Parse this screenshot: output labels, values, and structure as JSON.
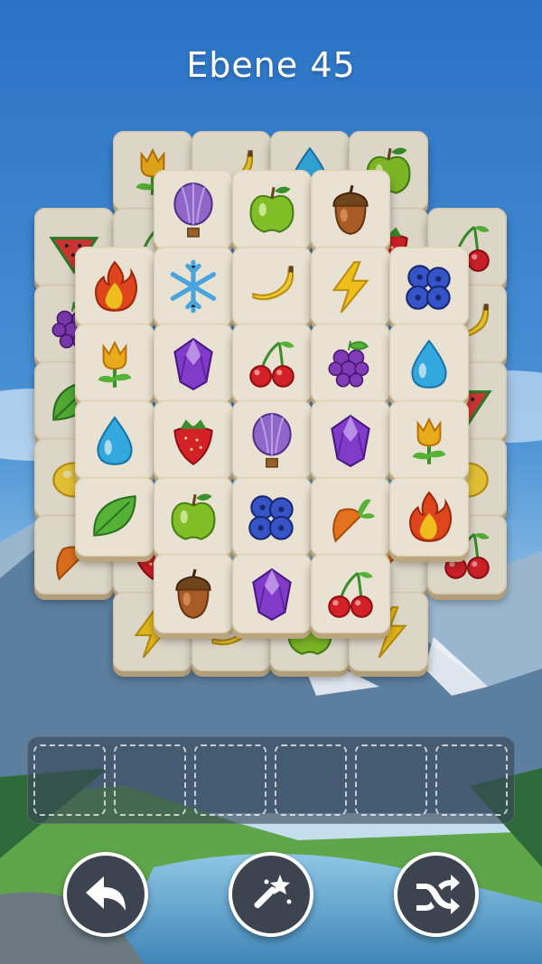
{
  "level": {
    "title": "Ebene 45"
  },
  "colors": {
    "tile_face": "#faf3e2",
    "tile_edge": "#c9b28a",
    "control_bg": "#3d4450"
  },
  "tray": {
    "slot_count": 6,
    "filled": 0
  },
  "controls": [
    {
      "name": "undo-button",
      "icon": "undo-arrow-icon"
    },
    {
      "name": "magic-wand-button",
      "icon": "magic-wand-icon"
    },
    {
      "name": "shuffle-button",
      "icon": "shuffle-icon"
    }
  ],
  "board": {
    "layers": [
      {
        "layer": 0,
        "tiles": [
          {
            "row": 0,
            "col": 1,
            "icon": "tulip"
          },
          {
            "row": 0,
            "col": 2,
            "icon": "banana"
          },
          {
            "row": 0,
            "col": 3,
            "icon": "drop"
          },
          {
            "row": 0,
            "col": 4,
            "icon": "apple"
          },
          {
            "row": 1,
            "col": 0,
            "icon": "watermelon"
          },
          {
            "row": 1,
            "col": 1,
            "icon": "cherry"
          },
          {
            "row": 1,
            "col": 4,
            "icon": "strawberry"
          },
          {
            "row": 1,
            "col": 5,
            "icon": "cherry"
          },
          {
            "row": 2,
            "col": 0,
            "icon": "grapes"
          },
          {
            "row": 2,
            "col": 5,
            "icon": "banana"
          },
          {
            "row": 3,
            "col": 0,
            "icon": "leaf"
          },
          {
            "row": 3,
            "col": 5,
            "icon": "watermelon"
          },
          {
            "row": 4,
            "col": 0,
            "icon": "lemon"
          },
          {
            "row": 4,
            "col": 5,
            "icon": "lemon"
          },
          {
            "row": 5,
            "col": 0,
            "icon": "carrot"
          },
          {
            "row": 5,
            "col": 1,
            "icon": "strawberry"
          },
          {
            "row": 5,
            "col": 4,
            "icon": "carrot"
          },
          {
            "row": 5,
            "col": 5,
            "icon": "cherry"
          },
          {
            "row": 6,
            "col": 1,
            "icon": "lightning"
          },
          {
            "row": 6,
            "col": 2,
            "icon": "banana"
          },
          {
            "row": 6,
            "col": 3,
            "icon": "apple"
          },
          {
            "row": 6,
            "col": 4,
            "icon": "lightning"
          }
        ]
      },
      {
        "layer": 1,
        "tiles": [
          {
            "row": 0,
            "col": 0,
            "icon": "balloon"
          },
          {
            "row": 0,
            "col": 1,
            "icon": "apple"
          },
          {
            "row": 0,
            "col": 2,
            "icon": "acorn"
          },
          {
            "row": 1,
            "col": -1,
            "icon": "fire"
          },
          {
            "row": 1,
            "col": 0,
            "icon": "snowflake"
          },
          {
            "row": 1,
            "col": 1,
            "icon": "banana"
          },
          {
            "row": 1,
            "col": 2,
            "icon": "lightning"
          },
          {
            "row": 1,
            "col": 3,
            "icon": "blueberry"
          },
          {
            "row": 2,
            "col": -1,
            "icon": "tulip"
          },
          {
            "row": 2,
            "col": 0,
            "icon": "gem"
          },
          {
            "row": 2,
            "col": 1,
            "icon": "cherry"
          },
          {
            "row": 2,
            "col": 2,
            "icon": "grapes"
          },
          {
            "row": 2,
            "col": 3,
            "icon": "drop"
          },
          {
            "row": 3,
            "col": -1,
            "icon": "drop"
          },
          {
            "row": 3,
            "col": 0,
            "icon": "strawberry"
          },
          {
            "row": 3,
            "col": 1,
            "icon": "balloon"
          },
          {
            "row": 3,
            "col": 2,
            "icon": "gem"
          },
          {
            "row": 3,
            "col": 3,
            "icon": "tulip"
          },
          {
            "row": 4,
            "col": -1,
            "icon": "leaf"
          },
          {
            "row": 4,
            "col": 0,
            "icon": "apple"
          },
          {
            "row": 4,
            "col": 1,
            "icon": "blueberry"
          },
          {
            "row": 4,
            "col": 2,
            "icon": "carrot"
          },
          {
            "row": 4,
            "col": 3,
            "icon": "fire"
          },
          {
            "row": 5,
            "col": 0,
            "icon": "acorn"
          },
          {
            "row": 5,
            "col": 1,
            "icon": "gem"
          },
          {
            "row": 5,
            "col": 2,
            "icon": "cherry"
          }
        ]
      }
    ]
  }
}
